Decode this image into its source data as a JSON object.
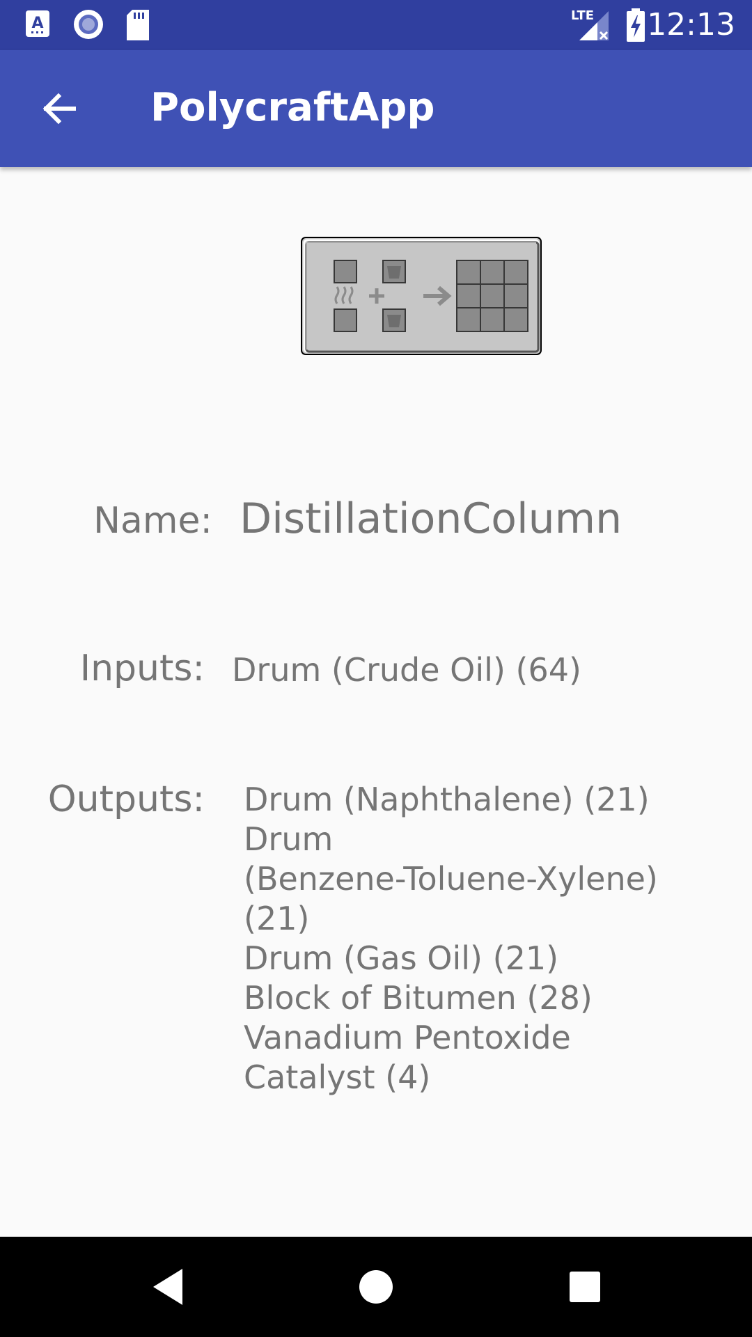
{
  "status_bar": {
    "time": "12:13",
    "network_label": "LTE",
    "icons": [
      "keyboard-a-icon",
      "record-icon",
      "sd-card-icon",
      "lte-signal-icon",
      "battery-charging-icon"
    ]
  },
  "app_bar": {
    "title": "PolycraftApp",
    "back_icon": "arrow-back-icon"
  },
  "recipe": {
    "image_icon": "distillation-recipe-grid-icon",
    "name_label": "Name:",
    "name_value": "DistillationColumn",
    "inputs_label": "Inputs:",
    "inputs_value": "Drum (Crude Oil) (64)",
    "outputs_label": "Outputs:",
    "outputs": [
      "Drum (Naphthalene) (21)",
      "Drum",
      "(Benzene-Toluene-Xylene) (21)",
      "Drum (Gas Oil) (21)",
      "Block of Bitumen (28)",
      "Vanadium Pentoxide",
      "Catalyst (4)"
    ]
  },
  "nav_bar": {
    "icons": [
      "nav-back-icon",
      "nav-home-icon",
      "nav-recents-icon"
    ]
  },
  "colors": {
    "status_bar": "#303f9f",
    "app_bar": "#3f51b5",
    "background": "#fafafa",
    "text_secondary": "#757575"
  }
}
